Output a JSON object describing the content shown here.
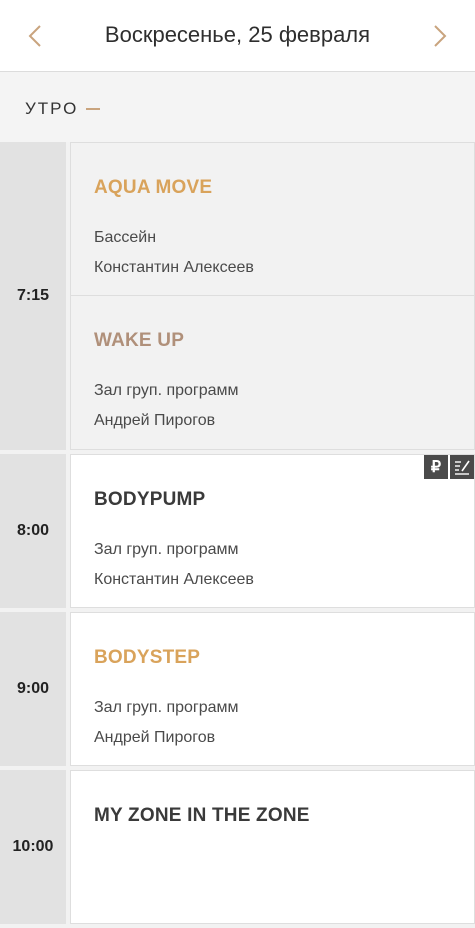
{
  "header": {
    "title": "Воскресенье, 25 февраля"
  },
  "section": {
    "label": "УТРО"
  },
  "slots": [
    {
      "time": "7:15",
      "classes": [
        {
          "name": "AQUA MOVE",
          "room": "Бассейн",
          "coach": "Константин Алексеев",
          "name_color": "#d9a35b",
          "state": "past"
        },
        {
          "name": "WAKE UP",
          "room": "Зал груп. программ",
          "coach": "Андрей Пирогов",
          "name_color": "#b0907a",
          "state": "past"
        }
      ]
    },
    {
      "time": "8:00",
      "classes": [
        {
          "name": "BODYPUMP",
          "room": "Зал груп. программ",
          "coach": "Константин Алексеев",
          "name_color": "#3a3a3a",
          "state": "active",
          "badges": [
            "ruble-icon",
            "edit-list-icon"
          ],
          "badge_text": [
            "₽"
          ]
        }
      ]
    },
    {
      "time": "9:00",
      "classes": [
        {
          "name": "BODYSTEP",
          "room": "Зал груп. программ",
          "coach": "Андрей Пирогов",
          "name_color": "#d9a35b",
          "state": "active"
        }
      ]
    },
    {
      "time": "10:00",
      "classes": [
        {
          "name": "MY ZONE IN THE ZONE",
          "room": "",
          "coach": "",
          "name_color": "#3a3a3a",
          "state": "active"
        }
      ]
    }
  ],
  "colors": {
    "accent": "#c9a47e",
    "time_bg": "#e2e2e2",
    "badge_bg": "#4a4a4a"
  }
}
